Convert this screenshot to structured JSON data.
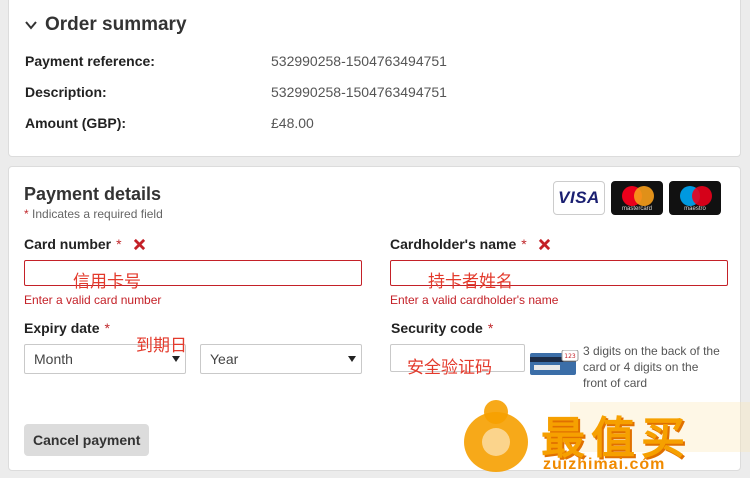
{
  "order_summary": {
    "title": "Order summary",
    "rows": [
      {
        "label": "Payment reference:",
        "value": "532990258-1504763494751"
      },
      {
        "label": "Description:",
        "value": "532990258-1504763494751"
      },
      {
        "label": "Amount (GBP):",
        "value": "£48.00"
      }
    ]
  },
  "payment": {
    "title": "Payment details",
    "required_star": "*",
    "required_note": " Indicates a required field",
    "cards": {
      "visa": "VISA",
      "mastercard": "mastercard",
      "maestro": "maestro"
    },
    "card_number": {
      "label": "Card number",
      "error": "Enter a valid card number",
      "annotation": "信用卡号"
    },
    "cardholder": {
      "label": "Cardholder's name",
      "error": "Enter a valid cardholder's name",
      "annotation": "持卡者姓名"
    },
    "expiry": {
      "label": "Expiry date",
      "month": "Month",
      "year": "Year",
      "annotation": "到期日"
    },
    "security": {
      "label": "Security code",
      "help": "3 digits on the back of the card or 4 digits on the front of card",
      "annotation": "安全验证码"
    },
    "cancel_label": "Cancel payment"
  },
  "watermark": {
    "text": "最值买",
    "url": "zuizhimai.cóm"
  },
  "colors": {
    "error": "#c42128",
    "annotation": "#e33a2c",
    "watermark": "#f6a000"
  }
}
